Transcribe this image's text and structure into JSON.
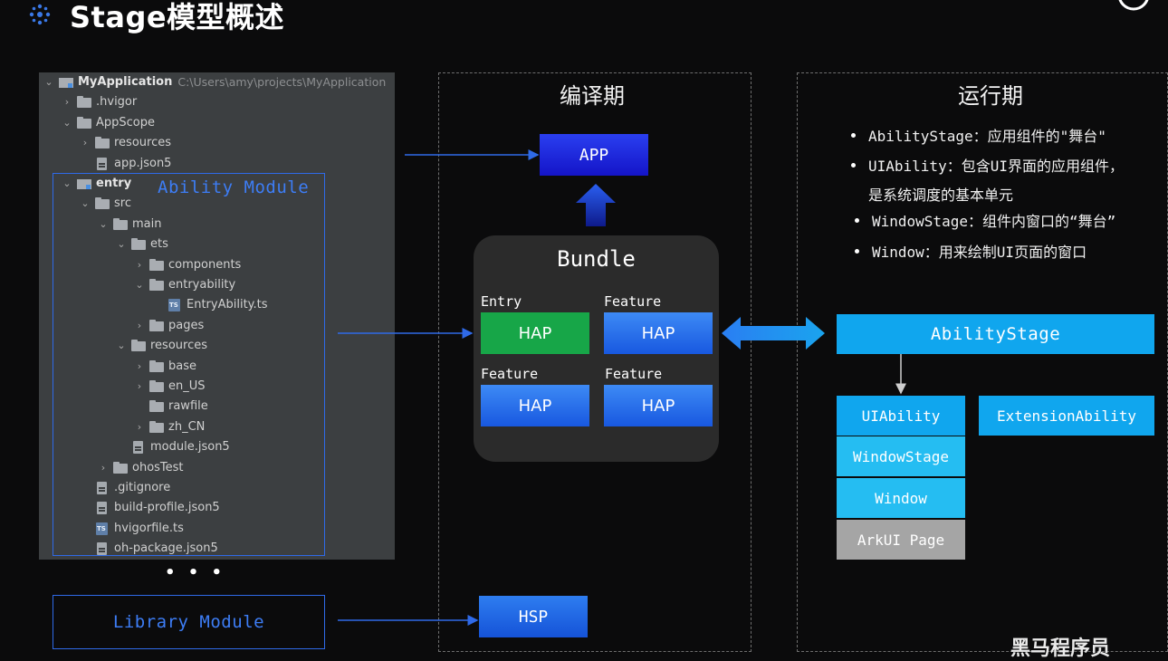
{
  "header": {
    "title": "Stage模型概述",
    "logo_icon": "snowflake-icon"
  },
  "tree": {
    "root_name": "MyApplication",
    "root_path": "C:\\Users\\amy\\projects\\MyApplication",
    "items": [
      {
        "label": "MyApplication",
        "type": "module-folder",
        "expanded": true
      },
      {
        "label": ".hvigor",
        "type": "folder",
        "expanded": false
      },
      {
        "label": "AppScope",
        "type": "folder",
        "expanded": true
      },
      {
        "label": "resources",
        "type": "folder",
        "expanded": false
      },
      {
        "label": "app.json5",
        "type": "file"
      },
      {
        "label": "entry",
        "type": "module-folder",
        "expanded": true
      },
      {
        "label": "src",
        "type": "folder",
        "expanded": true
      },
      {
        "label": "main",
        "type": "folder",
        "expanded": true
      },
      {
        "label": "ets",
        "type": "folder",
        "expanded": true
      },
      {
        "label": "components",
        "type": "folder",
        "expanded": false
      },
      {
        "label": "entryability",
        "type": "folder",
        "expanded": true
      },
      {
        "label": "EntryAbility.ts",
        "type": "ts-file"
      },
      {
        "label": "pages",
        "type": "folder",
        "expanded": false
      },
      {
        "label": "resources",
        "type": "folder",
        "expanded": true
      },
      {
        "label": "base",
        "type": "folder",
        "expanded": false
      },
      {
        "label": "en_US",
        "type": "folder",
        "expanded": false
      },
      {
        "label": "rawfile",
        "type": "folder"
      },
      {
        "label": "zh_CN",
        "type": "folder",
        "expanded": false
      },
      {
        "label": "module.json5",
        "type": "file"
      },
      {
        "label": "ohosTest",
        "type": "folder",
        "expanded": false
      },
      {
        "label": ".gitignore",
        "type": "file"
      },
      {
        "label": "build-profile.json5",
        "type": "file"
      },
      {
        "label": "hvigorfile.ts",
        "type": "ts-file"
      },
      {
        "label": "oh-package.json5",
        "type": "file"
      }
    ]
  },
  "modules": {
    "ability_label": "Ability Module",
    "ellipsis": "• • •",
    "library_label": "Library Module"
  },
  "compile": {
    "title": "编译期",
    "app_label": "APP",
    "bundle_title": "Bundle",
    "haps": [
      {
        "tag": "Entry",
        "label": "HAP"
      },
      {
        "tag": "Feature",
        "label": "HAP"
      },
      {
        "tag": "Feature",
        "label": "HAP"
      },
      {
        "tag": "Feature",
        "label": "HAP"
      }
    ],
    "hsp_label": "HSP"
  },
  "runtime": {
    "title": "运行期",
    "bullets": [
      "AbilityStage：应用组件的\"舞台\"",
      "UIAbility：包含UI界面的应用组件，",
      "是系统调度的基本单元",
      "WindowStage：组件内窗口的“舞台”",
      "Window：用来绘制UI页面的窗口"
    ],
    "abilitystage_label": "AbilityStage",
    "uiability_label": "UIAbility",
    "extension_label": "ExtensionAbility",
    "windowstage_label": "WindowStage",
    "window_label": "Window",
    "arkui_label": "ArkUI Page"
  },
  "watermark": "黑马程序员",
  "colors": {
    "background": "#0b0b0c",
    "accent_blue": "#2f6ae8",
    "entry_green": "#17a648",
    "runtime_cyan": "#10a6ee",
    "arkui_gray": "#a5a5a5"
  }
}
